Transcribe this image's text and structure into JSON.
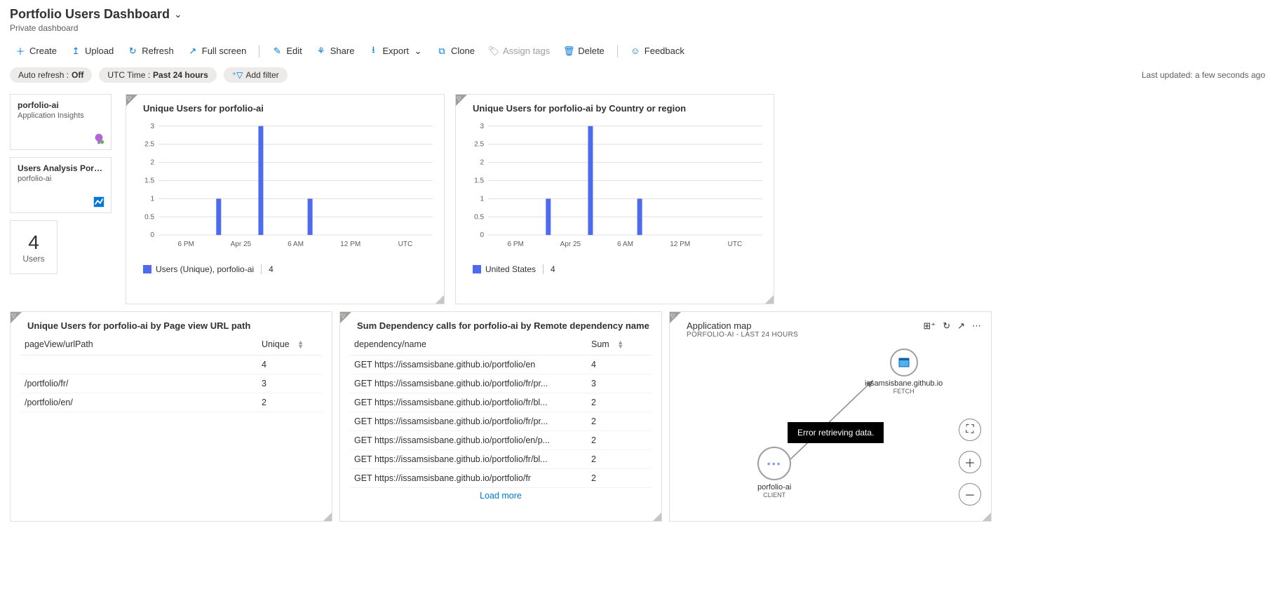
{
  "header": {
    "title": "Portfolio Users Dashboard",
    "subtitle": "Private dashboard"
  },
  "toolbar": {
    "create": "Create",
    "upload": "Upload",
    "refresh": "Refresh",
    "fullscreen": "Full screen",
    "edit": "Edit",
    "share": "Share",
    "export": "Export",
    "clone": "Clone",
    "assign_tags": "Assign tags",
    "delete": "Delete",
    "feedback": "Feedback"
  },
  "filters": {
    "autorefresh_label": "Auto refresh : ",
    "autorefresh_value": "Off",
    "timerange_label": "UTC Time : ",
    "timerange_value": "Past 24 hours",
    "add_filter": "Add filter",
    "last_updated": "Last updated: a few seconds ago"
  },
  "side_cards": {
    "card1": {
      "name": "porfolio-ai",
      "sub": "Application Insights"
    },
    "card2": {
      "name": "Users Analysis Portf...",
      "sub": "porfolio-ai"
    },
    "card3": {
      "value": "4",
      "label": "Users"
    }
  },
  "chart_data": [
    {
      "id": "chart1",
      "title": "Unique Users for porfolio-ai",
      "type": "bar",
      "xticks": [
        "6 PM",
        "Apr 25",
        "6 AM",
        "12 PM",
        "UTC"
      ],
      "yticks": [
        "0",
        "0.5",
        "1",
        "1.5",
        "2",
        "2.5",
        "3"
      ],
      "ylim": [
        0,
        3
      ],
      "bars": [
        {
          "xpos": 82,
          "value": 1
        },
        {
          "xpos": 142,
          "value": 3
        },
        {
          "xpos": 212,
          "value": 1
        }
      ],
      "legend_label": "Users (Unique), porfolio-ai",
      "legend_value": "4"
    },
    {
      "id": "chart2",
      "title": "Unique Users for porfolio-ai by Country or region",
      "type": "bar",
      "xticks": [
        "6 PM",
        "Apr 25",
        "6 AM",
        "12 PM",
        "UTC"
      ],
      "yticks": [
        "0",
        "0.5",
        "1",
        "1.5",
        "2",
        "2.5",
        "3"
      ],
      "ylim": [
        0,
        3
      ],
      "bars": [
        {
          "xpos": 82,
          "value": 1
        },
        {
          "xpos": 142,
          "value": 3
        },
        {
          "xpos": 212,
          "value": 1
        }
      ],
      "legend_label": "United States",
      "legend_value": "4"
    }
  ],
  "table1": {
    "title": "Unique Users for porfolio-ai by Page view URL path",
    "col1": "pageView/urlPath",
    "col2": "Unique",
    "rows": [
      {
        "c1": "<UNDEFINED>",
        "c2": "4"
      },
      {
        "c1": "/portfolio/fr/",
        "c2": "3"
      },
      {
        "c1": "/portfolio/en/",
        "c2": "2"
      }
    ]
  },
  "table2": {
    "title": "Sum Dependency calls for porfolio-ai by Remote dependency name",
    "col1": "dependency/name",
    "col2": "Sum",
    "rows": [
      {
        "c1": "GET https://issamsisbane.github.io/portfolio/en",
        "c2": "4"
      },
      {
        "c1": "GET https://issamsisbane.github.io/portfolio/fr/pr...",
        "c2": "3"
      },
      {
        "c1": "GET https://issamsisbane.github.io/portfolio/fr/bl...",
        "c2": "2"
      },
      {
        "c1": "GET https://issamsisbane.github.io/portfolio/fr/pr...",
        "c2": "2"
      },
      {
        "c1": "GET https://issamsisbane.github.io/portfolio/en/p...",
        "c2": "2"
      },
      {
        "c1": "GET https://issamsisbane.github.io/portfolio/fr/bl...",
        "c2": "2"
      },
      {
        "c1": "GET https://issamsisbane.github.io/portfolio/fr",
        "c2": "2"
      }
    ],
    "load_more": "Load more"
  },
  "appmap": {
    "title": "Application map",
    "subtitle": "PORFOLIO-AI - LAST 24 HOURS",
    "node1": {
      "label": "issamsisbane.github.io",
      "sub": "FETCH"
    },
    "node2": {
      "label": "porfolio-ai",
      "sub": "CLIENT"
    },
    "tooltip": "Error retrieving data."
  }
}
